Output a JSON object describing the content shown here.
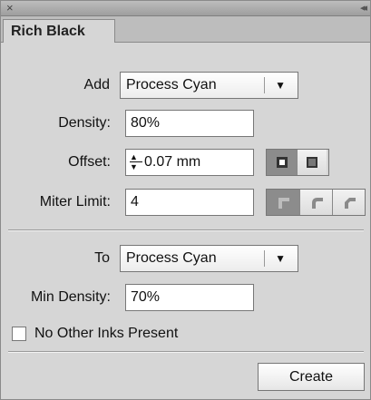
{
  "panel": {
    "close_glyph": "×",
    "collapse_glyph": "◂◂",
    "tab_label": "Rich Black"
  },
  "add": {
    "label": "Add",
    "value": "Process Cyan"
  },
  "density": {
    "label": "Density:",
    "value": "80%"
  },
  "offset": {
    "label": "Offset:",
    "value": "0.07 mm",
    "mode": "outside"
  },
  "miter": {
    "label": "Miter Limit:",
    "value": "4",
    "join": "miter"
  },
  "to": {
    "label": "To",
    "value": "Process Cyan"
  },
  "min_density": {
    "label": "Min Density:",
    "value": "70%"
  },
  "no_other_inks": {
    "label": "No Other Inks Present",
    "checked": false
  },
  "create_button": {
    "label": "Create"
  },
  "colors": {
    "panel_bg": "#d6d6d6",
    "toggle_on": "#8c8c8c"
  },
  "icons": [
    "close-icon",
    "collapse-icon",
    "dropdown-arrow-icon",
    "stepper-icon",
    "offset-outside-icon",
    "offset-inside-icon",
    "miter-join-icon",
    "round-join-icon",
    "bevel-join-icon"
  ]
}
